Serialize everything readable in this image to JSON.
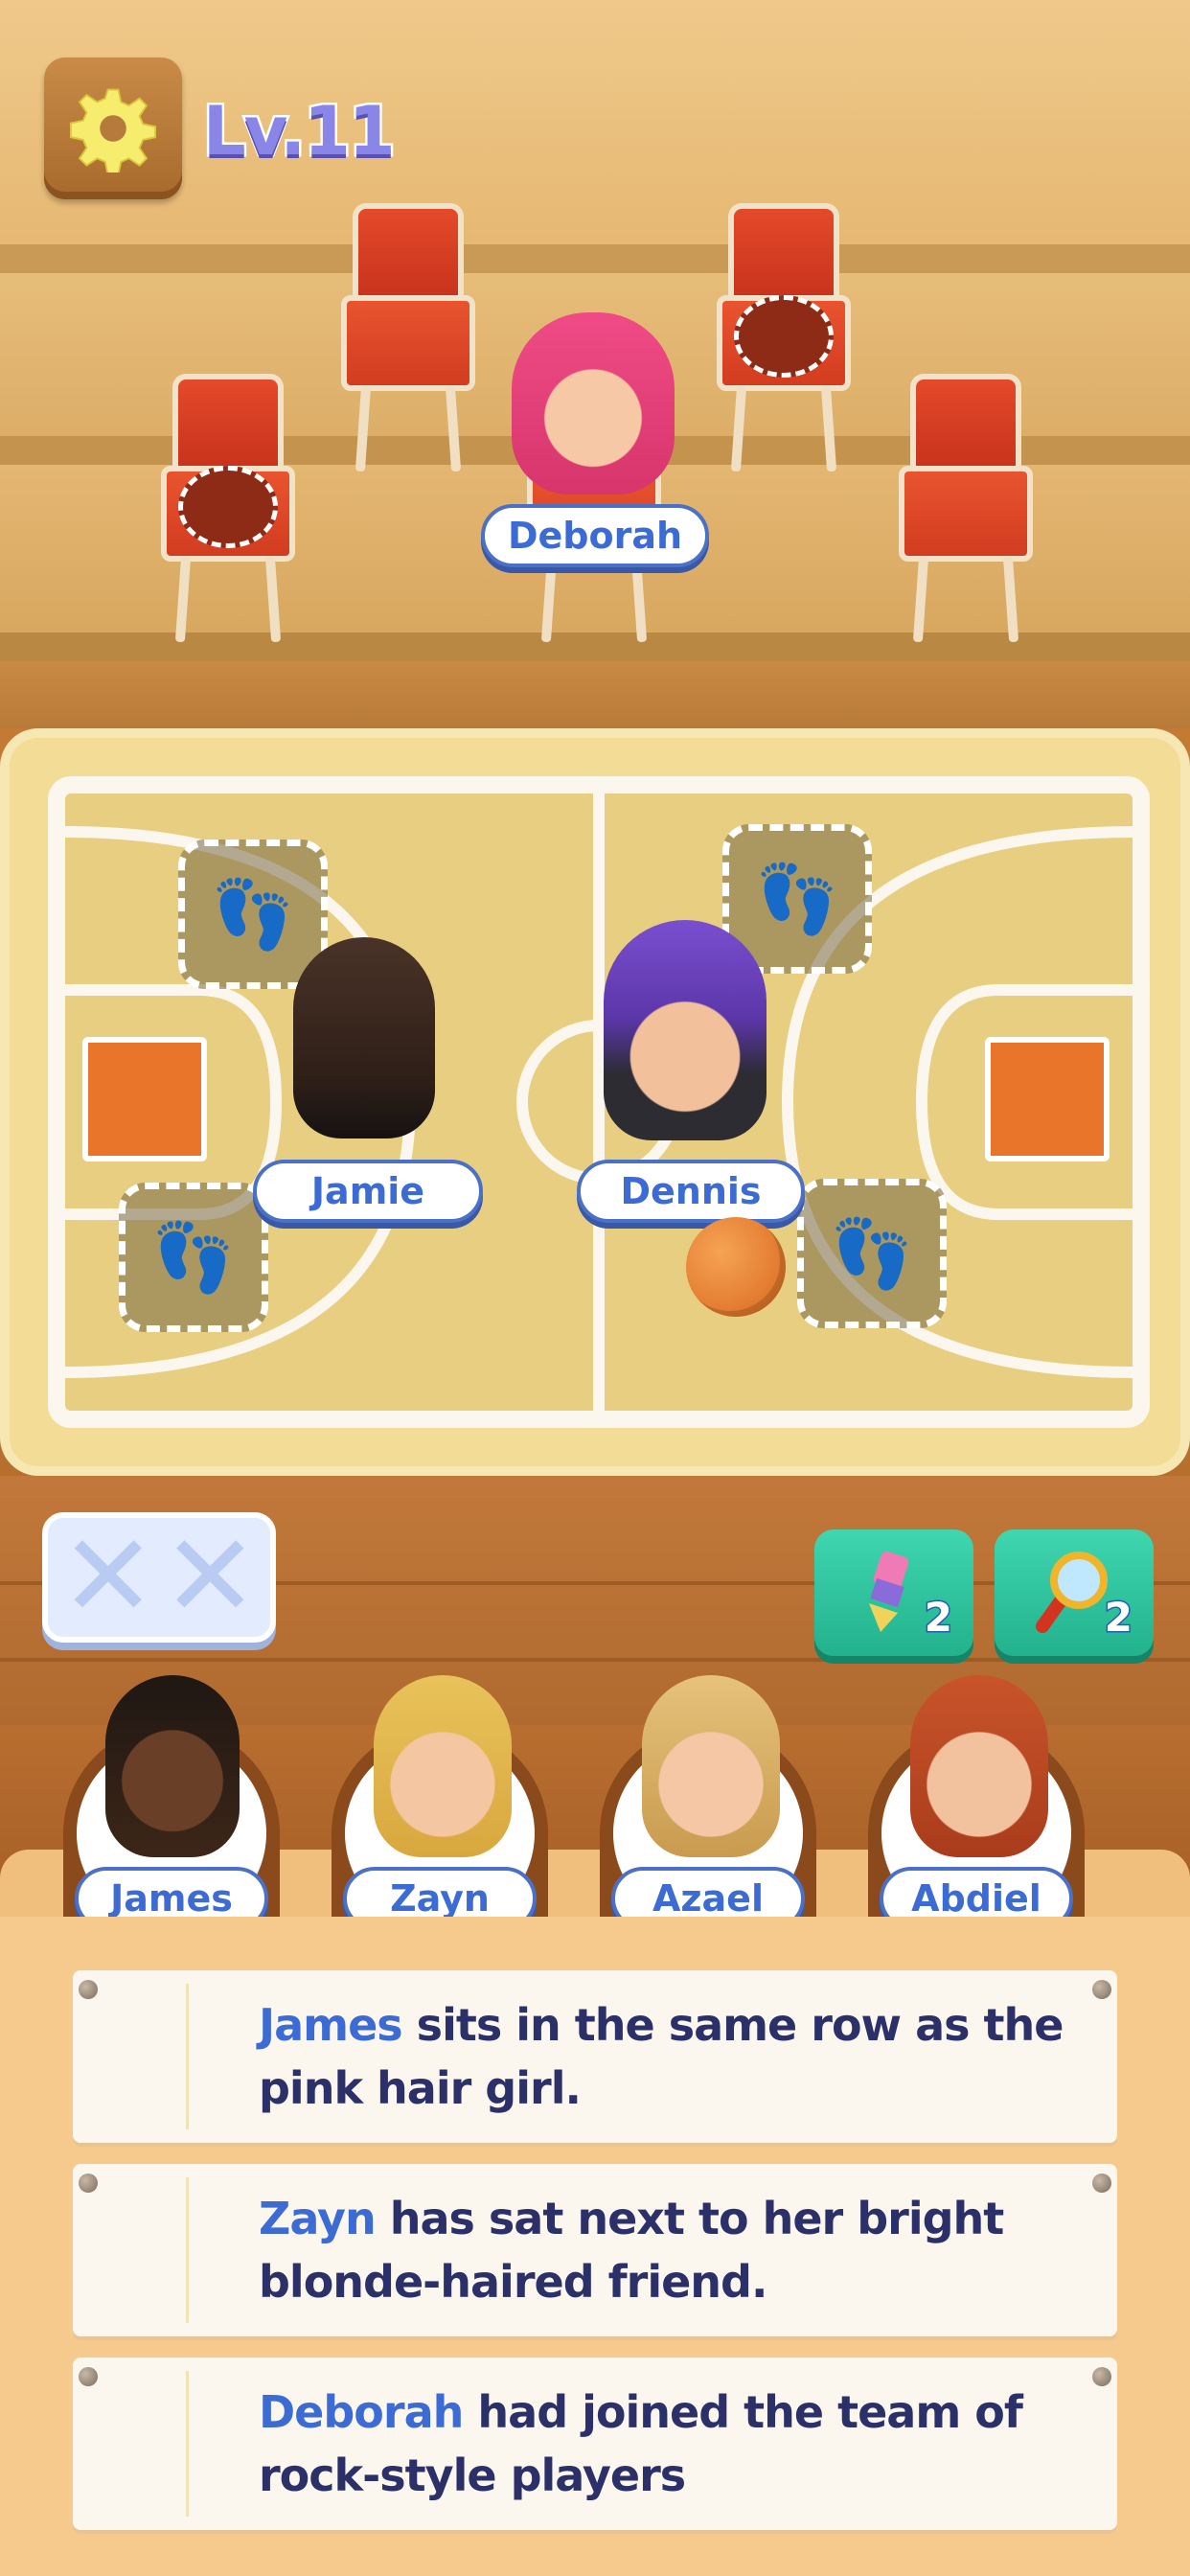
{
  "header": {
    "level_label": "Lv.11",
    "settings_icon": "gear-icon"
  },
  "stands": {
    "seated_name": "Deborah"
  },
  "court": {
    "players": [
      "Jamie",
      "Dennis"
    ]
  },
  "tools": {
    "mistakes_icon": "x-icon",
    "eraser": {
      "icon": "eraser-icon",
      "count": "2"
    },
    "magnifier": {
      "icon": "magnifier-icon",
      "count": "2"
    }
  },
  "characters": [
    {
      "name": "James"
    },
    {
      "name": "Zayn"
    },
    {
      "name": "Azael"
    },
    {
      "name": "Abdiel"
    }
  ],
  "clues": [
    {
      "name": "James",
      "rest": " sits in the same row as the pink hair girl."
    },
    {
      "name": "Zayn",
      "rest": " has sat next to her bright blonde-haired friend."
    },
    {
      "name": "Deborah",
      "rest": " had joined the team of rock-style players"
    }
  ],
  "colors": {
    "accent_blue": "#3c6bd4",
    "chair_red": "#d8411f",
    "tool_teal": "#2fc39c",
    "court_sand": "#e8ce80"
  }
}
